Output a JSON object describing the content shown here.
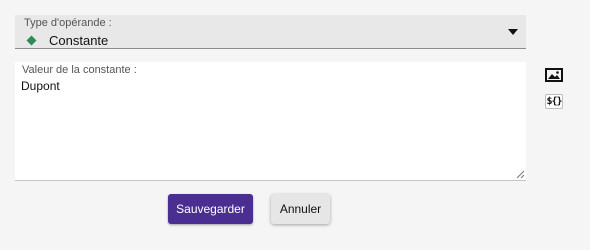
{
  "operand_select": {
    "label": "Type d'opérande :",
    "value": "Constante",
    "value_icon": "green-diamond-icon",
    "caret_icon": "caret-down-icon"
  },
  "constant_field": {
    "label": "Valeur de la constante :",
    "value": "Dupont"
  },
  "side_tools": {
    "image_icon": "image-icon",
    "variable_icon_text": "${}"
  },
  "actions": {
    "save_label": "Sauvegarder",
    "cancel_label": "Annuler"
  },
  "colors": {
    "accent": "#4b2e91",
    "diamond": "#2e8b57",
    "background": "#f5f5f5"
  }
}
